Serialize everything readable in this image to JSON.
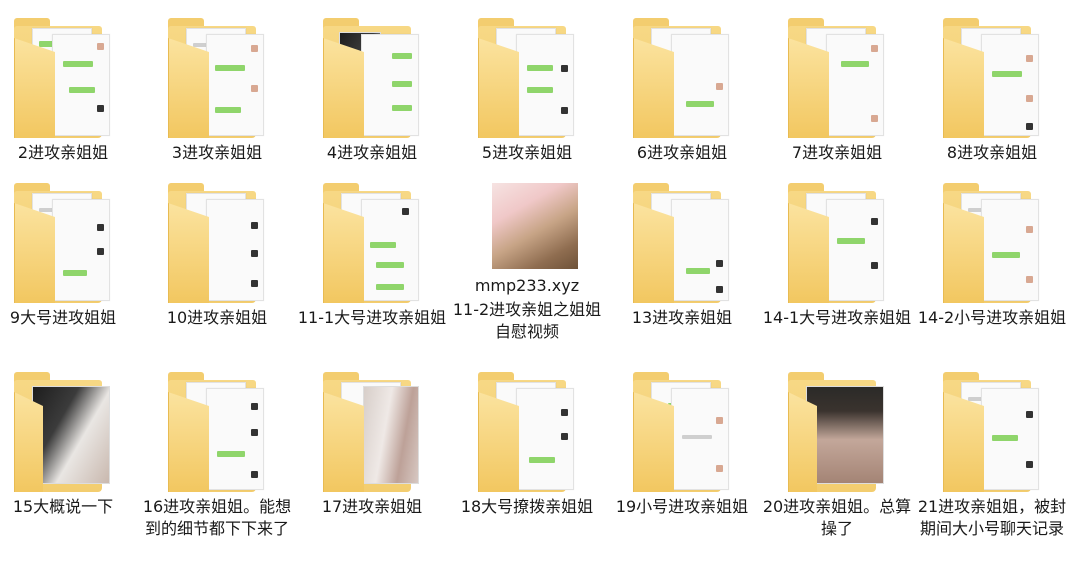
{
  "items": [
    {
      "label": "2进攻亲姐姐",
      "kind": "chat"
    },
    {
      "label": "3进攻亲姐姐",
      "kind": "chat"
    },
    {
      "label": "4进攻亲姐姐",
      "kind": "photo-dark"
    },
    {
      "label": "5进攻亲姐姐",
      "kind": "chat"
    },
    {
      "label": "6进攻亲姐姐",
      "kind": "chat"
    },
    {
      "label": "7进攻亲姐姐",
      "kind": "chat"
    },
    {
      "label": "8进攻亲姐姐",
      "kind": "chat"
    },
    {
      "label": "9大号进攻姐姐",
      "kind": "chat"
    },
    {
      "label": "10进攻亲姐姐",
      "kind": "chat"
    },
    {
      "label": "11-1大号进攻亲姐姐",
      "kind": "chat"
    },
    {
      "label": "11-2进攻亲姐之姐姐自慰视频",
      "kind": "image",
      "overlay": "mmp233.xyz"
    },
    {
      "label": "13进攻亲姐姐",
      "kind": "chat"
    },
    {
      "label": "14-1大号进攻亲姐姐",
      "kind": "chat"
    },
    {
      "label": "14-2小号进攻亲姐姐",
      "kind": "chat"
    },
    {
      "label": "15大概说一下",
      "kind": "photo-dark"
    },
    {
      "label": "16进攻亲姐姐。能想到的细节都下下来了",
      "kind": "chat"
    },
    {
      "label": "17进攻亲姐姐",
      "kind": "photo-wall"
    },
    {
      "label": "18大号撩拨亲姐姐",
      "kind": "chat"
    },
    {
      "label": "19小号进攻亲姐姐",
      "kind": "chat"
    },
    {
      "label": "20进攻亲姐姐。总算操了",
      "kind": "photo-room"
    },
    {
      "label": "21进攻亲姐姐，被封期间大小号聊天记录",
      "kind": "chat"
    }
  ]
}
